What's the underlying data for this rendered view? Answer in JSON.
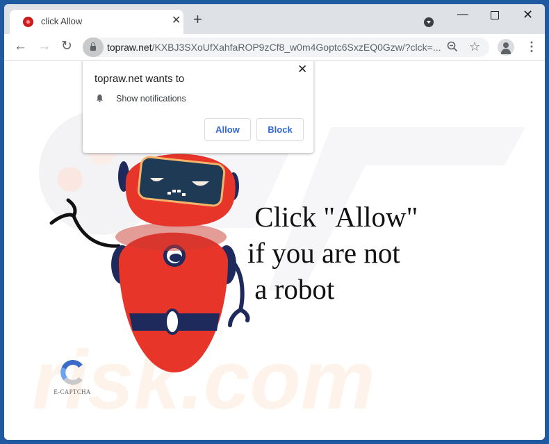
{
  "browser": {
    "tab": {
      "title": "click Allow",
      "close_icon": "close-icon"
    },
    "new_tab_icon": "plus-icon",
    "window_controls": {
      "minimize": "minimize-icon",
      "maximize": "maximize-icon",
      "close": "close-icon"
    },
    "toolbar": {
      "back_icon": "arrow-left-icon",
      "forward_icon": "arrow-right-icon",
      "reload_icon": "reload-icon",
      "url_domain": "topraw.net",
      "url_path": "/KXBJ3SXoUfXahfaROP9zCf8_w0m4Goptc6SxzEQ0Gzw/?clck=...",
      "zoom_icon": "zoom-out-icon",
      "bookmark_icon": "star-icon",
      "profile_icon": "avatar-icon",
      "menu_icon": "kebab-menu-icon"
    }
  },
  "permission_popup": {
    "title": "topraw.net wants to",
    "permission": "Show notifications",
    "allow_label": "Allow",
    "block_label": "Block"
  },
  "page": {
    "headline_lines": [
      " Click \"Allow\"",
      "if you are not",
      " a robot"
    ],
    "captcha_label": "E-CAPTCHA",
    "colors": {
      "robot_red": "#e8352a",
      "robot_navy": "#1f2a5c",
      "accent_blue": "#3367d6"
    }
  }
}
